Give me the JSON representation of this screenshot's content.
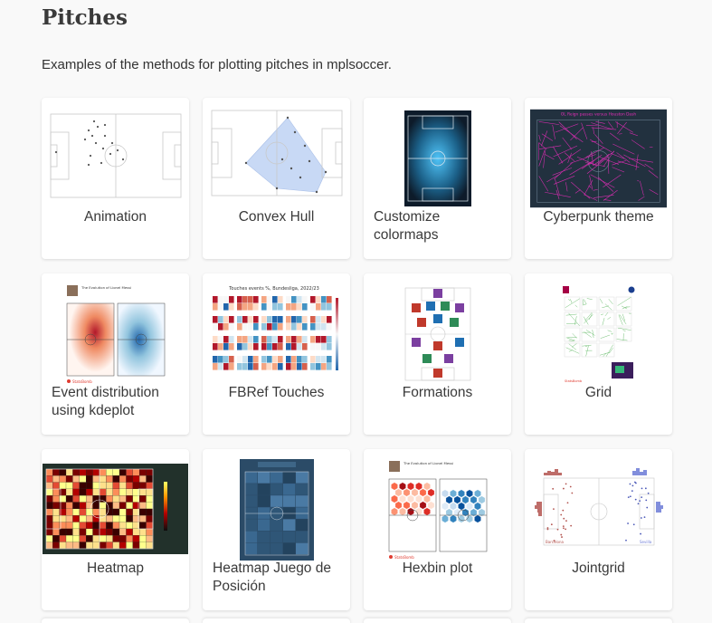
{
  "page": {
    "title": "Pitches",
    "intro": "Examples of the methods for plotting pitches in mplsoccer."
  },
  "cards": [
    {
      "label": "Animation"
    },
    {
      "label": "Convex Hull"
    },
    {
      "label": "Customize colormaps"
    },
    {
      "label": "Cyberpunk theme"
    },
    {
      "label": "Event distribution using kdeplot"
    },
    {
      "label": "FBRef Touches"
    },
    {
      "label": "Formations"
    },
    {
      "label": "Grid"
    },
    {
      "label": "Heatmap"
    },
    {
      "label": "Heatmap Juego de Posición"
    },
    {
      "label": "Hexbin plot"
    },
    {
      "label": "Jointgrid"
    }
  ],
  "thumbnails": {
    "cyberpunk_title": "OL Reign passes versus Houston Dash",
    "messi_title": "The Evolution of Lionel Messi",
    "statsbomb_brand": "StatsBomb",
    "fbref_title": "Touches events %, Bundesliga, 2022/23",
    "jointgrid_left": "Barcelona",
    "jointgrid_right": "Sevilla"
  },
  "colors": {
    "page_bg": "#f9f9f9",
    "card_bg": "#ffffff",
    "pitch_line": "#c9c9c9",
    "hull_fill": "#c8d9f5",
    "cyberpunk_bg": "#22313f",
    "cyberpunk_lines": "#ea2dbc",
    "kde_red": "#d73027",
    "kde_blue": "#2166ac",
    "heatmap_bg": "#22312b",
    "heatmap_jdp_bg": "#2b4b67"
  }
}
